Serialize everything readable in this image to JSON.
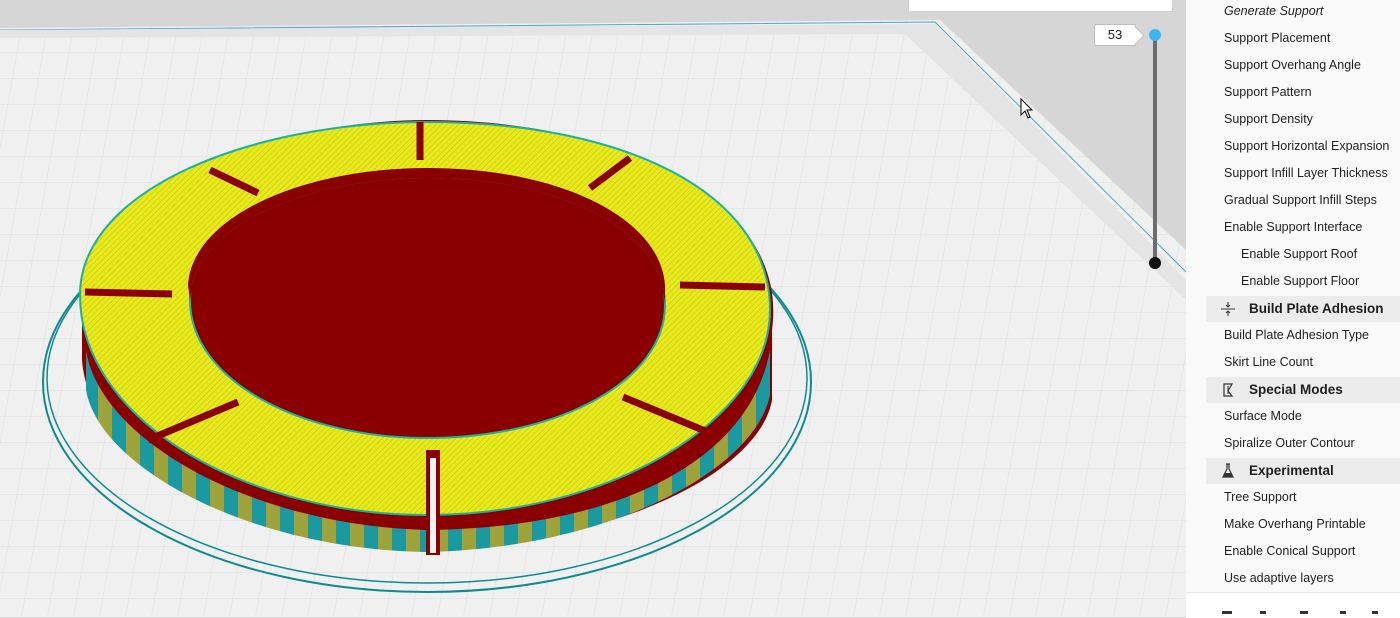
{
  "viewport": {
    "layer_number": "53",
    "colors": {
      "top_skin": "#e8ea1c",
      "walls": "#8a0000",
      "inner_wall": "#1bb0a0",
      "skirt": "#0f8a90",
      "build_plate": "#f2f2f2",
      "grid_line": "#dedede",
      "slider_handle_top": "#3db7ef"
    }
  },
  "settings": {
    "support": [
      {
        "label": "Generate Support",
        "italic": true
      },
      {
        "label": "Support Placement"
      },
      {
        "label": "Support Overhang Angle"
      },
      {
        "label": "Support Pattern"
      },
      {
        "label": "Support Density"
      },
      {
        "label": "Support Horizontal Expansion"
      },
      {
        "label": "Support Infill Layer Thickness"
      },
      {
        "label": "Gradual Support Infill Steps"
      },
      {
        "label": "Enable Support Interface"
      },
      {
        "label": "Enable Support Roof",
        "indent": true
      },
      {
        "label": "Enable Support Floor",
        "indent": true
      }
    ],
    "categories": {
      "adhesion": {
        "title": "Build Plate Adhesion",
        "icon": "adhesion-icon"
      },
      "special": {
        "title": "Special Modes",
        "icon": "special-modes-icon"
      },
      "experimental": {
        "title": "Experimental",
        "icon": "flask-icon"
      }
    },
    "adhesion_items": [
      "Build Plate Adhesion Type",
      "Skirt Line Count"
    ],
    "special_items": [
      "Surface Mode",
      "Spiralize Outer Contour"
    ],
    "experimental_items": [
      "Tree Support",
      "Make Overhang Printable",
      "Enable Conical Support",
      "Use adaptive layers"
    ]
  }
}
